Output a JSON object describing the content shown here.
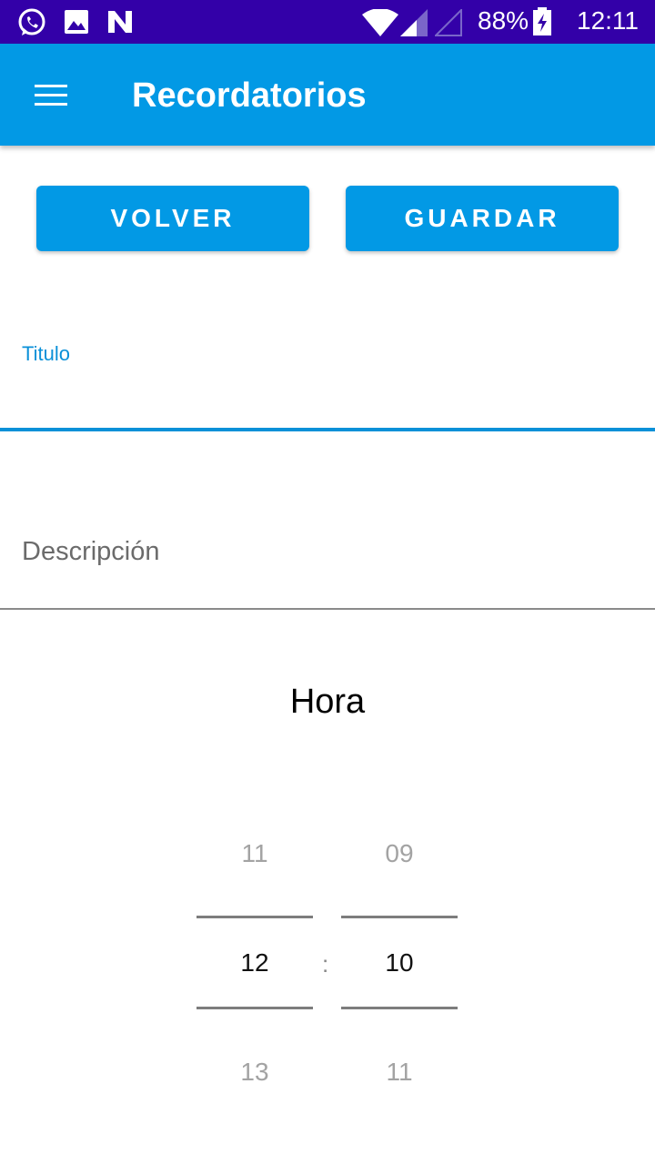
{
  "status_bar": {
    "battery_percent": "88%",
    "time": "12:11",
    "icons": [
      "whatsapp-icon",
      "image-icon",
      "n-app-icon",
      "wifi-icon",
      "signal-icon",
      "signal-empty-icon",
      "battery-charging-icon"
    ]
  },
  "app_bar": {
    "title": "Recordatorios",
    "menu_icon": "hamburger-menu-icon"
  },
  "buttons": {
    "back_label": "VOLVER",
    "save_label": "GUARDAR"
  },
  "form": {
    "title_label": "Titulo",
    "title_value": "",
    "description_placeholder": "Descripción",
    "time_heading": "Hora"
  },
  "time_picker": {
    "hours": {
      "prev": "11",
      "selected": "12",
      "next": "13"
    },
    "separator": ":",
    "minutes": {
      "prev": "09",
      "selected": "10",
      "next": "11"
    }
  },
  "colors": {
    "status_bar": "#3300a8",
    "primary": "#0299e5",
    "accent": "#0a90d8"
  }
}
